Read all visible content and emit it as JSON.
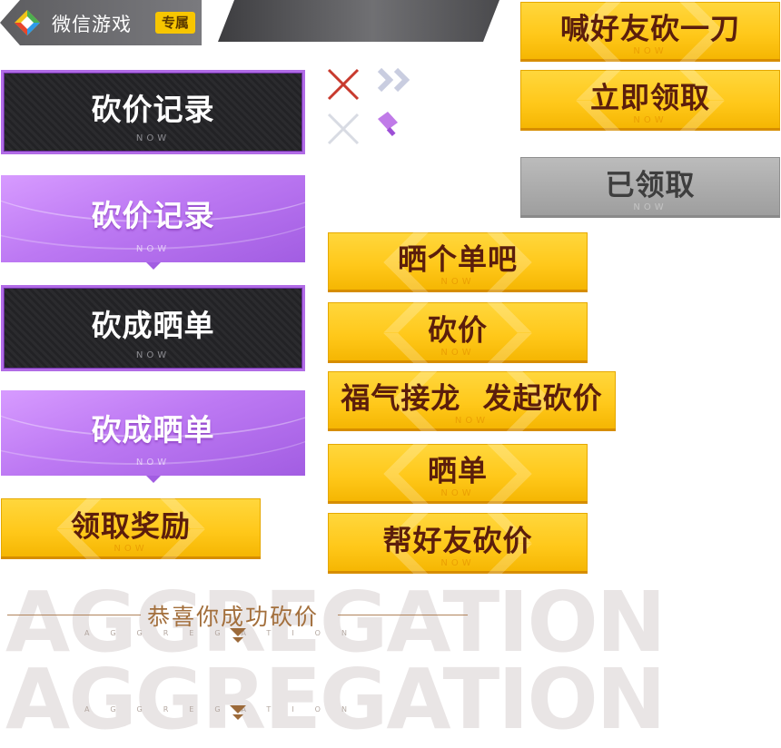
{
  "header": {
    "app_name": "微信游戏",
    "tag": "专属"
  },
  "tabs": [
    {
      "label": "砍价记录",
      "sub": "NOW",
      "style": "dark"
    },
    {
      "label": "砍价记录",
      "sub": "NOW",
      "style": "purple"
    },
    {
      "label": "砍成晒单",
      "sub": "NOW",
      "style": "dark"
    },
    {
      "label": "砍成晒单",
      "sub": "NOW",
      "style": "purple"
    }
  ],
  "buttons": {
    "claim_reward": {
      "label": "领取奖励",
      "sub": "NOW"
    },
    "call_friend": {
      "label": "喊好友砍一刀",
      "sub": "NOW"
    },
    "claim_now": {
      "label": "立即领取",
      "sub": "NOW"
    },
    "claimed": {
      "label": "已领取",
      "sub": "NOW"
    },
    "share_order": {
      "label": "晒个单吧",
      "sub": "NOW"
    },
    "bargain": {
      "label": "砍价",
      "sub": "NOW"
    },
    "relay_start": {
      "label": "福气接龙  发起砍价",
      "sub": "NOW"
    },
    "share": {
      "label": "晒单",
      "sub": "NOW"
    },
    "help_friend": {
      "label": "帮好友砍价",
      "sub": "NOW"
    }
  },
  "icons": [
    "close-red-icon",
    "close-gray-icon",
    "double-chevron-icon",
    "cleaver-icon"
  ],
  "banners": [
    {
      "bg_text": "AGGREGATION",
      "title": "恭喜你成功砍价",
      "sub": "AGGREGATION"
    },
    {
      "bg_text": "AGGREGATION",
      "title": "",
      "sub": "AGGREGATION"
    }
  ],
  "colors": {
    "accent_yellow": "#ffc81a",
    "button_text": "#5b1e0c",
    "purple": "#bd79f3",
    "dark": "#262629",
    "banner_title": "#a36f3c"
  }
}
